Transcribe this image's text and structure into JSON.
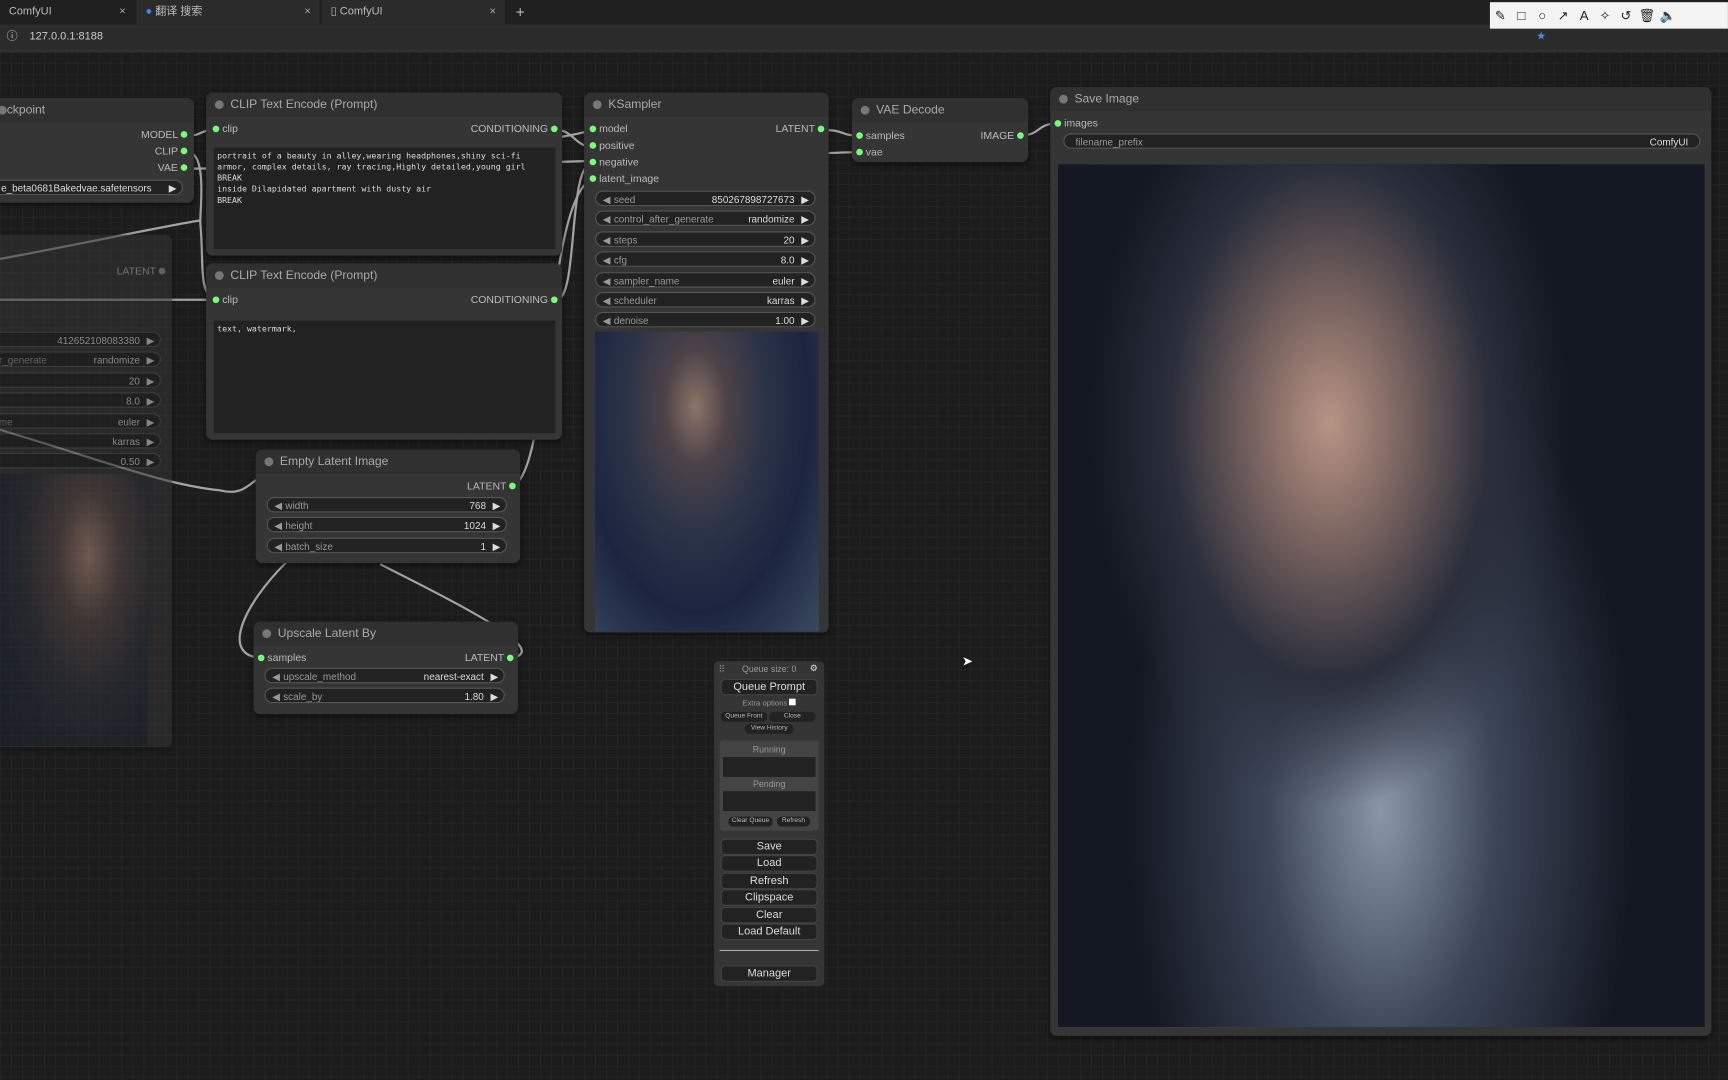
{
  "browser": {
    "tabs": [
      {
        "label": "ComfyUI",
        "close": "×"
      },
      {
        "label": "翻译 搜索",
        "close": "×"
      },
      {
        "label": "ComfyUI",
        "close": "×"
      }
    ],
    "new_tab": "+",
    "address": "127.0.0.1:8188",
    "toolbar_icons": [
      "pencil-icon",
      "rectangle-icon",
      "circle-icon",
      "arrow-icon",
      "text-icon",
      "magic-wand-icon",
      "undo-icon",
      "trash-icon",
      "speaker-icon"
    ]
  },
  "checkpoint": {
    "title": "eckpoint",
    "outputs": [
      "MODEL",
      "CLIP",
      "VAE"
    ],
    "ckpt_name": "e_beta0681Bakedvae.safetensors"
  },
  "ksampler2": {
    "output": "LATENT",
    "values": [
      "412652108083380",
      "randomize",
      "20",
      "8.0",
      "euler",
      "karras",
      "0.50"
    ],
    "labels": [
      "",
      "r_generate",
      "",
      "",
      "me",
      "",
      ""
    ]
  },
  "clip1": {
    "title": "CLIP Text Encode (Prompt)",
    "input": "clip",
    "output": "CONDITIONING",
    "text": "portrait of a beauty in alley,wearing headphones,shiny sci-fi armor, complex details, ray tracing,Highly detailed,young girl\nBREAK\ninside Dilapidated apartment with dusty air\nBREAK"
  },
  "clip2": {
    "title": "CLIP Text Encode (Prompt)",
    "input": "clip",
    "output": "CONDITIONING",
    "text": "text, watermark,"
  },
  "ksampler": {
    "title": "KSampler",
    "inputs": [
      "model",
      "positive",
      "negative",
      "latent_image"
    ],
    "output": "LATENT",
    "widgets": [
      {
        "label": "seed",
        "value": "850267898727673"
      },
      {
        "label": "control_after_generate",
        "value": "randomize"
      },
      {
        "label": "steps",
        "value": "20"
      },
      {
        "label": "cfg",
        "value": "8.0"
      },
      {
        "label": "sampler_name",
        "value": "euler"
      },
      {
        "label": "scheduler",
        "value": "karras"
      },
      {
        "label": "denoise",
        "value": "1.00"
      }
    ]
  },
  "vae": {
    "title": "VAE Decode",
    "inputs": [
      "samples",
      "vae"
    ],
    "output": "IMAGE"
  },
  "save": {
    "title": "Save Image",
    "input": "images",
    "prefix_label": "filename_prefix",
    "prefix_value": "ComfyUI"
  },
  "latent": {
    "title": "Empty Latent Image",
    "output": "LATENT",
    "widgets": [
      {
        "label": "width",
        "value": "768"
      },
      {
        "label": "height",
        "value": "1024"
      },
      {
        "label": "batch_size",
        "value": "1"
      }
    ]
  },
  "upscale": {
    "title": "Upscale Latent By",
    "input": "samples",
    "output": "LATENT",
    "widgets": [
      {
        "label": "upscale_method",
        "value": "nearest-exact"
      },
      {
        "label": "scale_by",
        "value": "1.80"
      }
    ]
  },
  "queue": {
    "size": "Queue size: 0",
    "queue_prompt": "Queue Prompt",
    "extra": "Extra options",
    "queue_front": "Queue Front",
    "close": "Close",
    "history": "View History",
    "running": "Running",
    "pending": "Pending",
    "clear_queue": "Clear Queue",
    "refresh_small": "Refresh",
    "buttons": [
      "Save",
      "Load",
      "Refresh",
      "Clipspace",
      "Clear",
      "Load Default"
    ],
    "manager": "Manager"
  }
}
